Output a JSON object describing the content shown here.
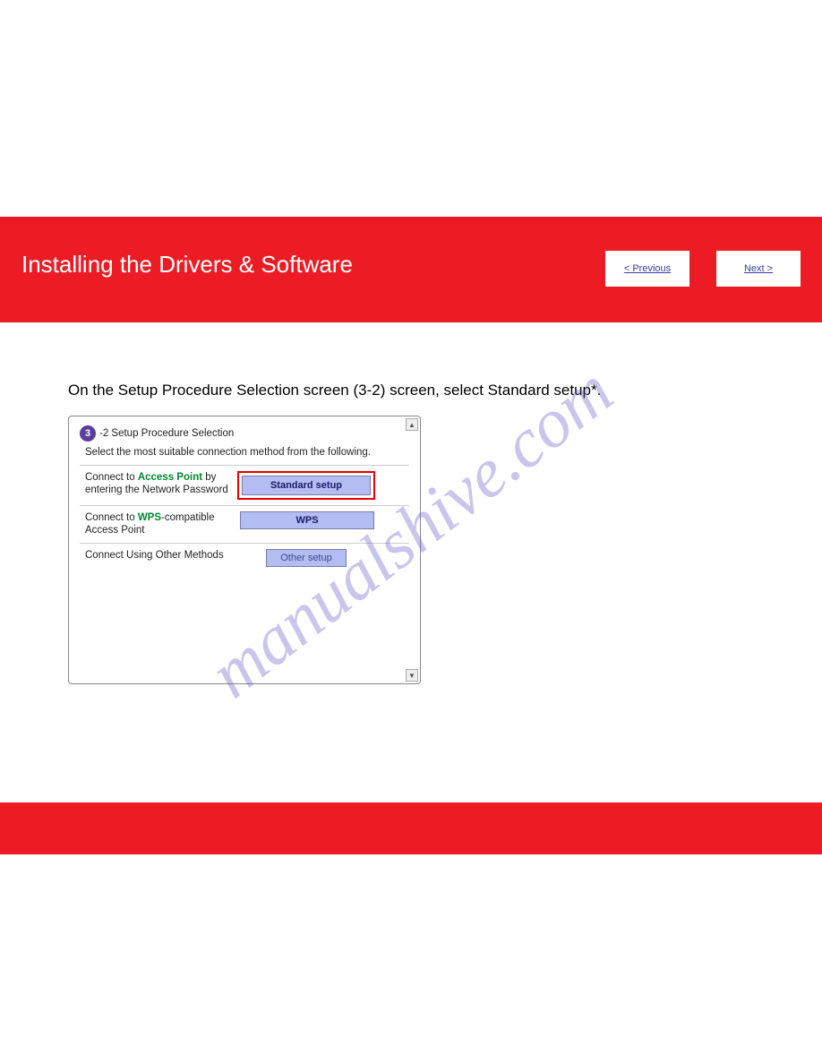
{
  "header": {
    "title": "Installing the Drivers & Software",
    "links": [
      {
        "label": "< Previous"
      },
      {
        "label": "Next >"
      }
    ]
  },
  "instruction": "On the Setup Procedure Selection screen (3-2) screen, select Standard setup*.",
  "dialog": {
    "step_number": "3",
    "step_suffix": "-2 Setup Procedure Selection",
    "subtitle": "Select the most suitable connection method from the following.",
    "options": [
      {
        "text_pre": "Connect to ",
        "text_green": "Access Point",
        "text_post": " by entering the Network Password",
        "button": "Standard setup"
      },
      {
        "text_pre": "Connect to ",
        "text_green": "WPS",
        "text_post": "-compatible Access Point",
        "button": "WPS"
      },
      {
        "text_pre": "Connect Using Other Methods",
        "text_green": "",
        "text_post": "",
        "button": "Other setup"
      }
    ]
  },
  "watermark": "manualshive.com"
}
